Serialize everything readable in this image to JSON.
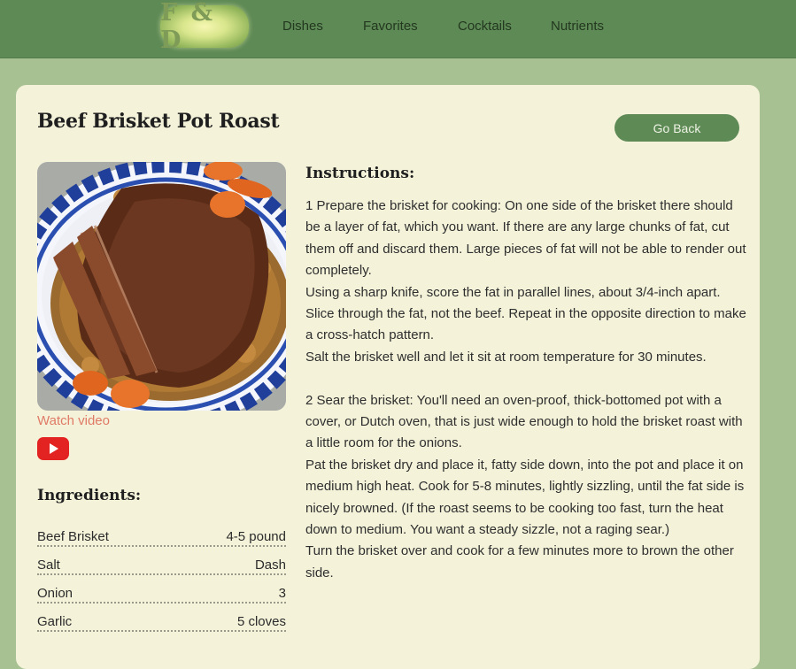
{
  "header": {
    "logo_text": "F & D",
    "nav": [
      "Dishes",
      "Favorites",
      "Cocktails",
      "Nutrients"
    ]
  },
  "recipe": {
    "title": "Beef Brisket Pot Roast",
    "back_label": "Go Back",
    "watch_video_label": "Watch video",
    "ingredients_heading": "Ingredients:",
    "ingredients": [
      {
        "name": "Beef Brisket",
        "amount": "4-5 pound"
      },
      {
        "name": "Salt",
        "amount": "Dash"
      },
      {
        "name": "Onion",
        "amount": "3"
      },
      {
        "name": "Garlic",
        "amount": "5 cloves"
      }
    ],
    "instructions_heading": "Instructions:",
    "instructions": [
      "1 Prepare the brisket for cooking: On one side of the brisket there should be a layer of fat, which you want. If there are any large chunks of fat, cut them off and discard them. Large pieces of fat will not be able to render out completely.",
      "Using a sharp knife, score the fat in parallel lines, about 3/4-inch apart. Slice through the fat, not the beef. Repeat in the opposite direction to make a cross-hatch pattern.",
      "Salt the brisket well and let it sit at room temperature for 30 minutes.",
      "",
      "2 Sear the brisket: You'll need an oven-proof, thick-bottomed pot with a cover, or Dutch oven, that is just wide enough to hold the brisket roast with a little room for the onions.",
      "Pat the brisket dry and place it, fatty side down, into the pot and place it on medium high heat. Cook for 5-8 minutes, lightly sizzling, until the fat side is nicely browned. (If the roast seems to be cooking too fast, turn the heat down to medium. You want a steady sizzle, not a raging sear.)",
      "Turn the brisket over and cook for a few minutes more to brown the other side."
    ]
  },
  "colors": {
    "header": "#5e8a56",
    "page_bg": "#a7c192",
    "card_bg": "#f4f3da",
    "link": "#e07a66",
    "youtube": "#e32222"
  },
  "icons": {
    "video_icon": "youtube-play-icon"
  }
}
